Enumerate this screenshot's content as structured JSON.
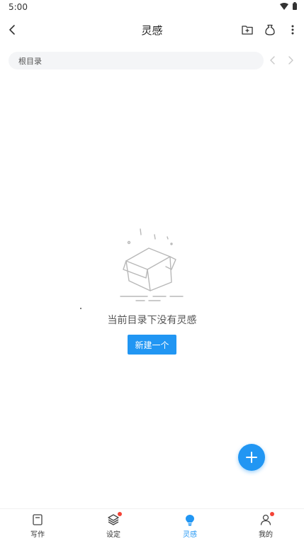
{
  "status_bar": {
    "time": "5:00"
  },
  "app_bar": {
    "title": "灵感"
  },
  "path": {
    "label": "根目录"
  },
  "empty_state": {
    "message": "当前目录下没有灵感",
    "create_label": "新建一个"
  },
  "bottom_nav": {
    "items": [
      {
        "label": "写作",
        "icon": "document-icon",
        "badge": false
      },
      {
        "label": "设定",
        "icon": "layers-icon",
        "badge": true
      },
      {
        "label": "灵感",
        "icon": "lightbulb-icon",
        "badge": false,
        "active": true
      },
      {
        "label": "我的",
        "icon": "person-icon",
        "badge": true
      }
    ]
  },
  "colors": {
    "accent": "#2196f3",
    "badge": "#f44336",
    "pill_bg": "#f4f5f7"
  }
}
